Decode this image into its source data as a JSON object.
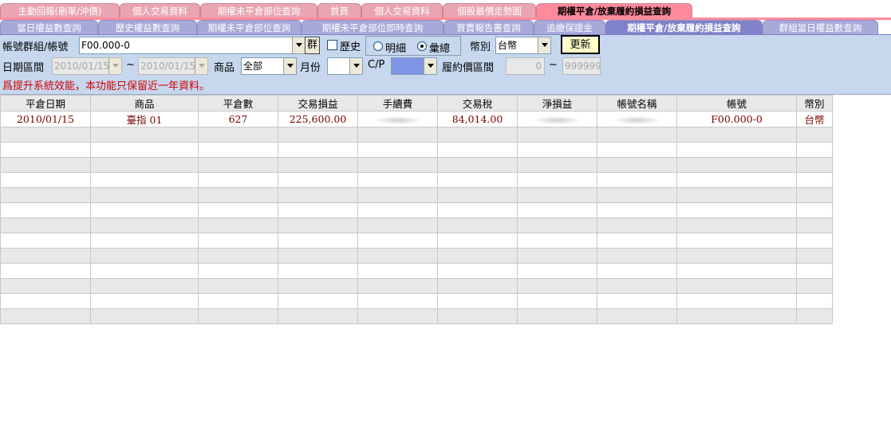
{
  "tabs_row1": [
    {
      "label": "主動回報(刪單/沖價)",
      "active": false
    },
    {
      "label": "個人交易資料",
      "active": false
    },
    {
      "label": "期權未平倉部位查詢",
      "active": false
    },
    {
      "label": "首頁",
      "active": false
    },
    {
      "label": "個人交易資料",
      "active": false
    },
    {
      "label": "個股最價走勢圖",
      "active": false
    },
    {
      "label": "期權平倉/放棄履約損益查詢",
      "active": true
    }
  ],
  "tabs_row2": [
    {
      "label": "當日權益數查詢",
      "active": false
    },
    {
      "label": "歷史權益數查詢",
      "active": false
    },
    {
      "label": "期權未平倉部位查詢",
      "active": false
    },
    {
      "label": "期權未平倉部位即時查詢",
      "active": false
    },
    {
      "label": "買賣報告書查詢",
      "active": false
    },
    {
      "label": "追繳保證金",
      "active": false
    },
    {
      "label": "期權平倉/放棄履約損益查詢",
      "active": true
    },
    {
      "label": "群組當日權益數查詢",
      "active": false
    }
  ],
  "form": {
    "account_label": "帳號群組/帳號",
    "account_value": "F00.000-0",
    "group_button": "群",
    "history_label": "歷史",
    "detail_label": "明細",
    "summary_label": "彙總",
    "currency_label": "幣別",
    "currency_value": "台幣",
    "refresh_button": "更新",
    "date_label": "日期區間",
    "date_from": "2010/01/15",
    "date_to": "2010/01/15",
    "tilde": "~",
    "product_label": "商品",
    "product_value": "全部",
    "month_label": "月份",
    "cp_label": "C/P",
    "strike_label": "履約價區間",
    "strike_from": "0",
    "strike_to": "999999",
    "warning": "爲提升系統效能，本功能只保留近一年資料。"
  },
  "table": {
    "columns": [
      "平倉日期",
      "商品",
      "平倉數",
      "交易損益",
      "手續費",
      "交易稅",
      "淨損益",
      "帳號名稱",
      "帳號",
      "幣別"
    ],
    "rows": [
      [
        "2010/01/15",
        "臺指 01",
        "627",
        "225,600.00",
        "",
        "84,014.00",
        "",
        "",
        "F00.000-0",
        "台幣"
      ]
    ]
  }
}
